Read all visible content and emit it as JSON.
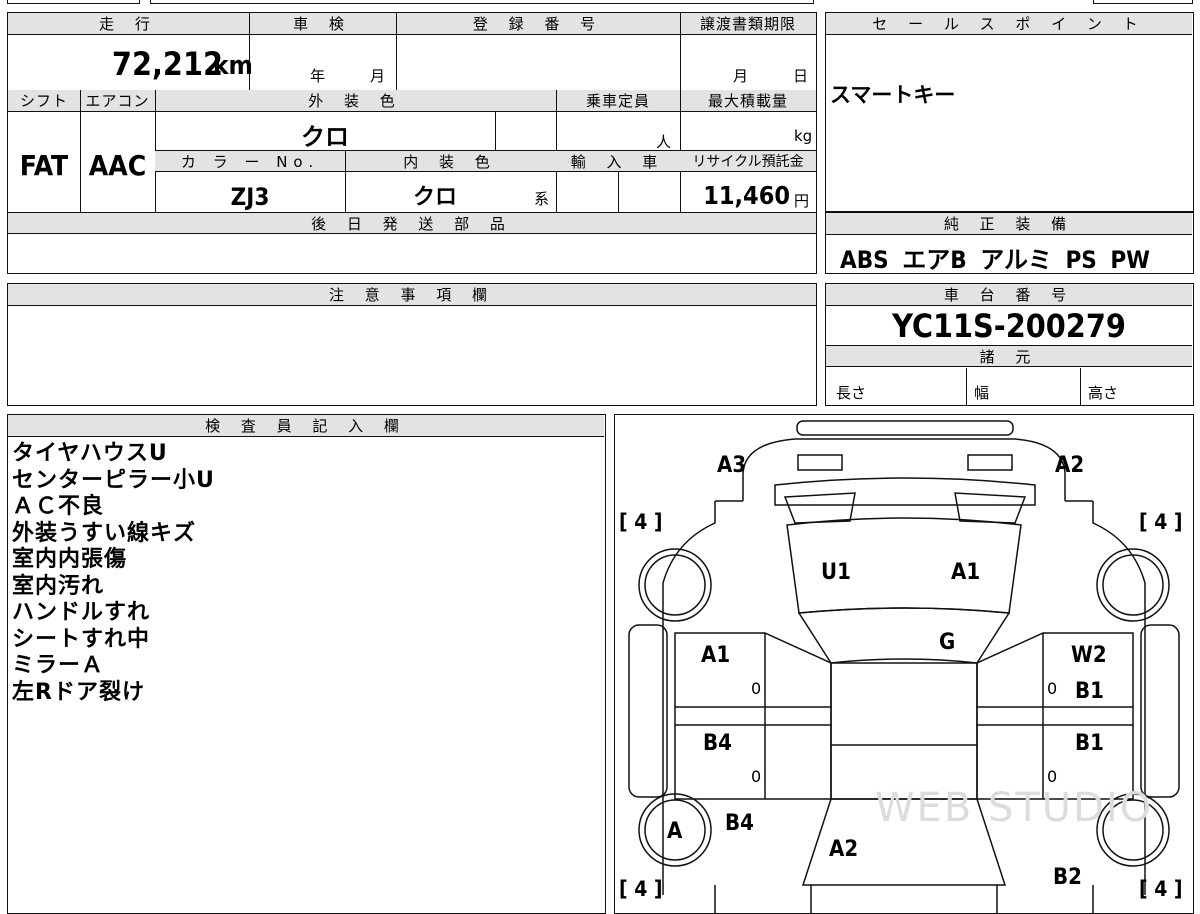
{
  "top_form": {
    "mileage_label": "走 行",
    "mileage_value": "72,212",
    "mileage_unit": "km",
    "inspection_label": "車 検",
    "inspection_year": "年",
    "inspection_month": "月",
    "registration_label": "登 録 番 号",
    "transfer_label": "譲渡書類期限",
    "transfer_month": "月",
    "transfer_day": "日",
    "shift_label": "シフト",
    "shift_value": "FAT",
    "ac_label": "エアコン",
    "ac_value": "AAC",
    "exterior_label": "外 装 色",
    "exterior_value": "クロ",
    "capacity_label": "乗車定員",
    "capacity_unit": "人",
    "max_load_label": "最大積載量",
    "max_load_unit": "kg",
    "color_no_label": "カ ラ ー No.",
    "color_no_value": "ZJ3",
    "interior_label": "内 装 色",
    "interior_value": "クロ",
    "interior_suffix": "系",
    "import_label": "輸 入 車",
    "recycle_label": "リサイクル預託金",
    "recycle_value": "11,460",
    "recycle_unit": "円",
    "later_parts_label": "後 日 発 送 部 品"
  },
  "sales_point": {
    "label": "セ ー ル ス ポ イ ン ト",
    "value": "スマートキー"
  },
  "equipment": {
    "label": "純 正 装 備",
    "value": "ABS エアB アルミ PS PW"
  },
  "caution": {
    "label": "注 意 事 項 欄"
  },
  "chassis": {
    "label": "車 台 番 号",
    "value": "YC11S-200279",
    "specs_label": "諸 元",
    "length_label": "長さ",
    "width_label": "幅",
    "height_label": "高さ"
  },
  "inspector": {
    "label": "検 査 員 記 入 欄",
    "notes": [
      "タイヤハウスU",
      "センターピラー小U",
      "ＡＣ不良",
      "外装うすい線キズ",
      "室内内張傷",
      "室内汚れ",
      "ハンドルすれ",
      "シートすれ中",
      "ミラーＡ",
      "左Rドア裂け"
    ]
  },
  "diagram": {
    "tire_front_left": "[ 4 ]",
    "tire_front_right": "[ 4 ]",
    "tire_rear_left": "[ 4 ]",
    "tire_rear_right": "[ 4 ]",
    "mark_a3": "A3",
    "mark_a2_top": "A2",
    "mark_u1": "U1",
    "mark_a1_hood": "A1",
    "mark_g": "G",
    "mark_a1_left_door": "A1",
    "mark_w2": "W2",
    "mark_b1_right_front": "B1",
    "mark_b4_left_rear": "B4",
    "mark_b1_right_rear": "B1",
    "mark_a_wheel": "A",
    "mark_b4_left_quarter": "B4",
    "mark_a2_rear": "A2",
    "mark_b2": "B2",
    "zero_1": "0",
    "zero_2": "0",
    "zero_3": "0",
    "zero_4": "0"
  }
}
